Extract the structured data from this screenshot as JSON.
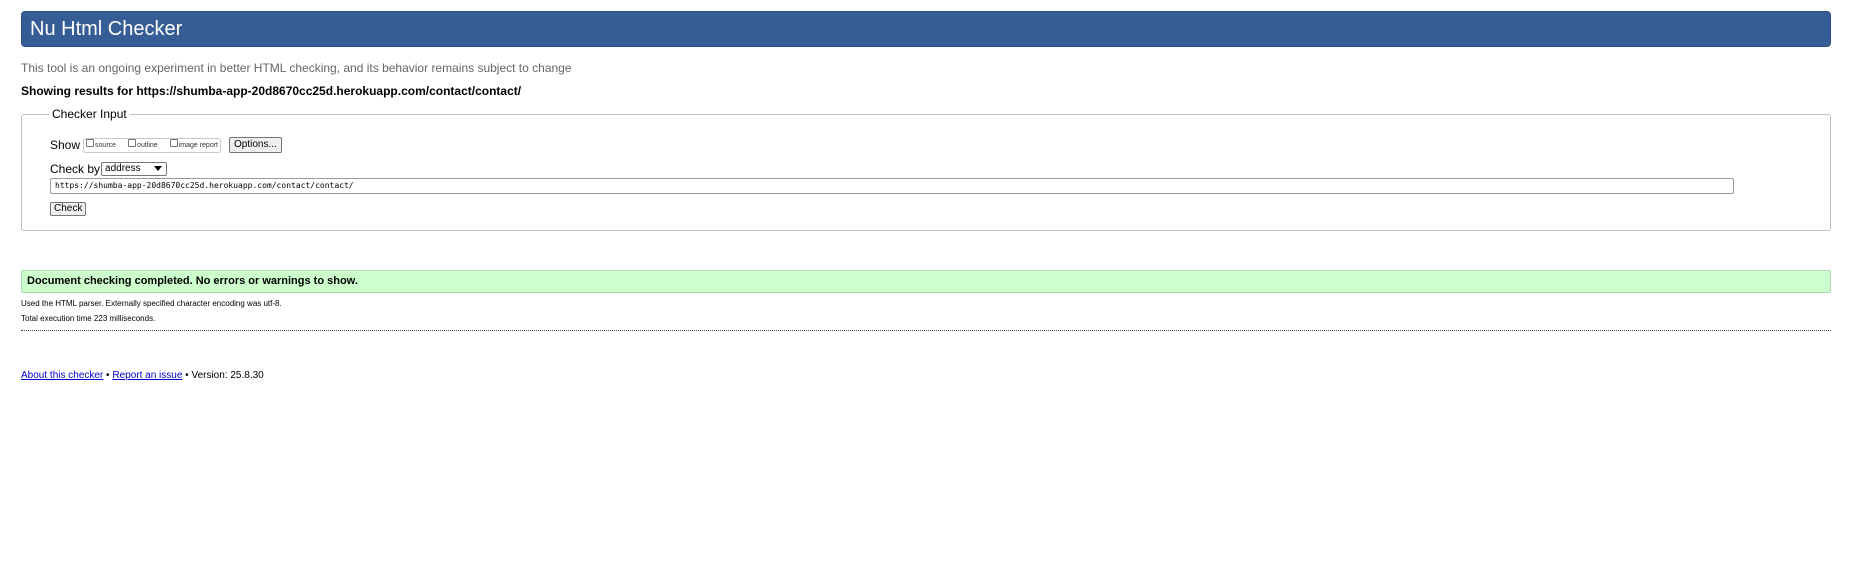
{
  "header": {
    "title": "Nu Html Checker"
  },
  "intro": "This tool is an ongoing experiment in better HTML checking, and its behavior remains subject to change",
  "showing_results": "Showing results for https://shumba-app-20d8670cc25d.herokuapp.com/contact/contact/",
  "checker_input": {
    "legend": "Checker Input",
    "show_label": "Show",
    "show_options": [
      {
        "label": "source",
        "checked": false
      },
      {
        "label": "outline",
        "checked": false
      },
      {
        "label": "image report",
        "checked": false
      }
    ],
    "options_button": "Options...",
    "check_by_label": "Check by",
    "check_by_selected": "address",
    "url_value": "https://shumba-app-20d8670cc25d.herokuapp.com/contact/contact/",
    "check_button": "Check"
  },
  "result": {
    "status": "Document checking completed. No errors or warnings to show.",
    "parser_info": "Used the HTML parser. Externally specified character encoding was utf-8.",
    "execution_time": "Total execution time 223 milliseconds."
  },
  "footer": {
    "about_link": "About this checker",
    "separator": "•",
    "report_link": "Report an issue",
    "version": "• Version: 25.8.30"
  },
  "colors": {
    "title_bar": "#365d95",
    "success_bg": "#ccffcc",
    "link": "#0000cc"
  }
}
